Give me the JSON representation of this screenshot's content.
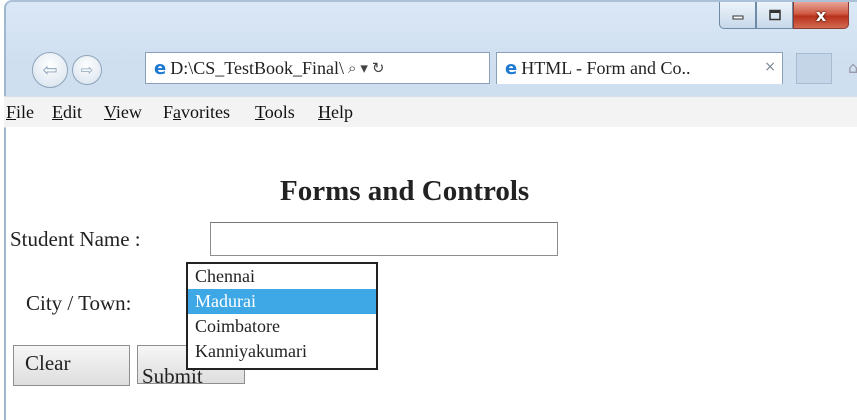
{
  "browser": {
    "address": "D:\\CS_TestBook_Final\\",
    "tab_title": "HTML - Form and Co..",
    "tab_close": "×",
    "window_controls": {
      "minimize_icon": "minimize-icon",
      "maximize_icon": "maximize-icon",
      "close_label": "x"
    }
  },
  "menu": {
    "items": [
      {
        "accel": "F",
        "rest": "ile"
      },
      {
        "accel": "E",
        "rest": "dit"
      },
      {
        "accel": "V",
        "rest": "iew"
      },
      {
        "pre": "F",
        "accel": "a",
        "rest": "vorites"
      },
      {
        "accel": "T",
        "rest": "ools"
      },
      {
        "accel": "H",
        "rest": "elp"
      }
    ]
  },
  "page": {
    "title": "Forms and Controls",
    "student_name_label": "Student Name :",
    "student_name_value": "",
    "city_label": "City / Town:",
    "city_options": [
      "Chennai",
      "Madurai",
      "Coimbatore",
      "Kanniyakumari"
    ],
    "city_selected": "Madurai",
    "clear_label": "Clear",
    "submit_label": "Submit"
  },
  "colors": {
    "selection": "#3ea8e6",
    "ie_blue": "#1d78d2",
    "close_red": "#c9432c"
  }
}
